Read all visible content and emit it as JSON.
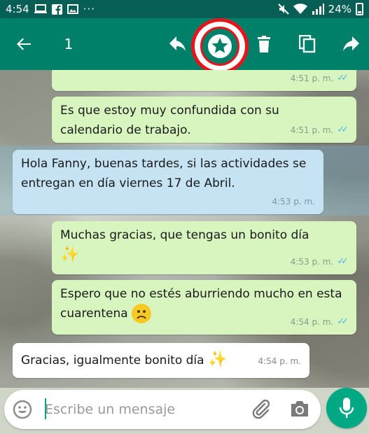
{
  "status_bar": {
    "time": "4:54",
    "battery": "24%"
  },
  "action_bar": {
    "selected_count": "1",
    "icons": [
      "back-arrow-icon",
      "reply-icon",
      "star-icon",
      "delete-icon",
      "copy-icon",
      "forward-icon"
    ],
    "highlight_color": "#e8141c"
  },
  "messages": [
    {
      "type": "outgoing",
      "text": "",
      "time": "4:51 p. m.",
      "read": true
    },
    {
      "type": "outgoing",
      "text": "Es que estoy muy confundida con su calendario de trabajo.",
      "time": "4:51 p. m.",
      "read": true
    },
    {
      "type": "incoming",
      "selected": true,
      "text": "Hola Fanny, buenas tardes, si las actividades se entregan en día viernes 17 de Abril.",
      "time": "4:53 p. m."
    },
    {
      "type": "outgoing",
      "text": "Muchas gracias, que tengas un bonito día",
      "emoji": "✨",
      "time": "4:53 p. m.",
      "read": true
    },
    {
      "type": "outgoing",
      "text": "Espero que no estés aburriendo mucho en esta cuarentena",
      "emoji": "☹",
      "time": "4:54 p. m.",
      "read": true
    },
    {
      "type": "incoming",
      "text": "Gracias, igualmente bonito día",
      "emoji": "✨",
      "time": "4:54 p. m."
    }
  ],
  "input": {
    "placeholder": "Escribe un mensaje"
  },
  "colors": {
    "header": "#008069",
    "status_bar": "#075e54",
    "outgoing_bubble": "#d8f5bf",
    "incoming_bubble": "#ffffff",
    "selected_bubble": "#c5e3f3",
    "accent": "#00a884",
    "read_ticks": "#4fb6ec"
  }
}
